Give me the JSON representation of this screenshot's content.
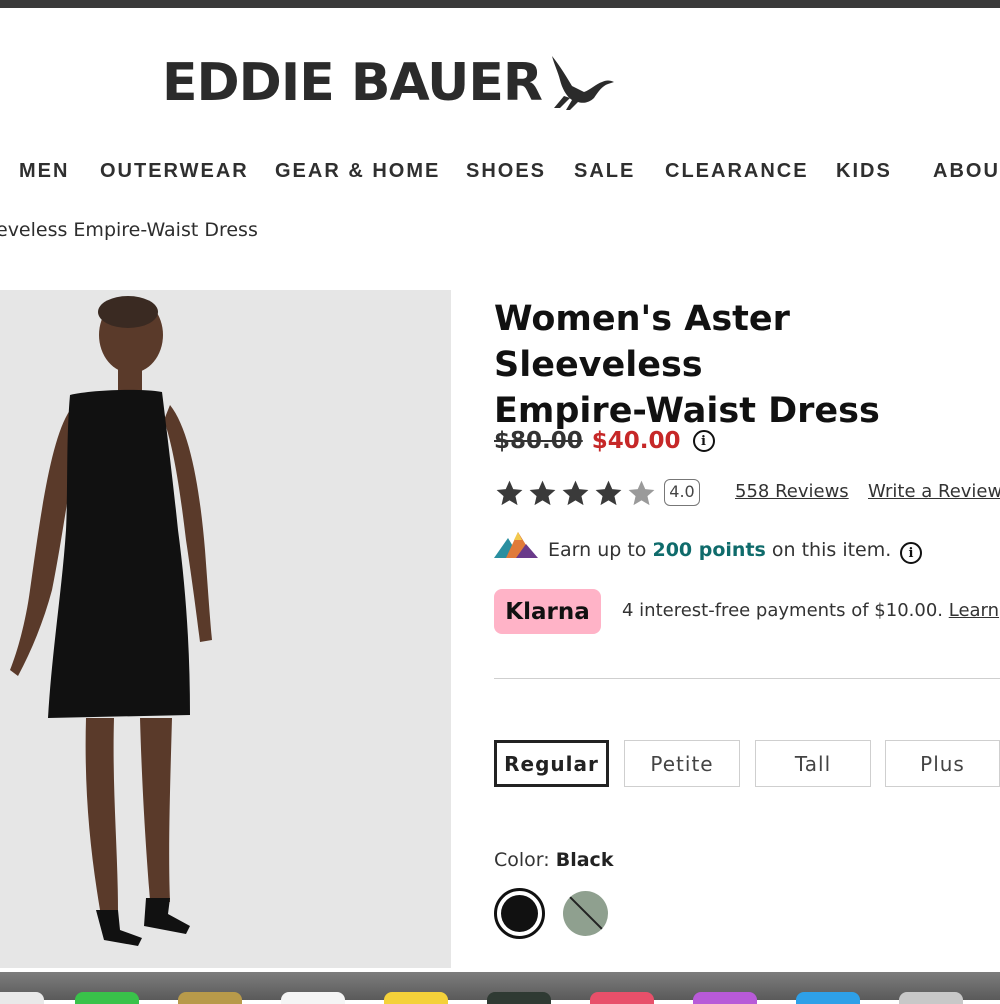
{
  "brand": {
    "name": "EDDIE BAUER",
    "bird_icon": "goose-logo-icon"
  },
  "nav": {
    "items": [
      "MEN",
      "OUTERWEAR",
      "GEAR & HOME",
      "SHOES",
      "SALE",
      "CLEARANCE",
      "KIDS",
      "ABOUT"
    ]
  },
  "breadcrumb": "eveless Empire-Waist Dress",
  "product": {
    "title_line1": "Women's Aster Sleeveless",
    "title_line2": "Empire-Waist Dress",
    "price_original": "$80.00",
    "price_sale": "$40.00",
    "sale_color": "#c62828",
    "rating_value": 4.0,
    "rating_label": "4.0",
    "reviews_link": "558 Reviews",
    "write_review_link": "Write a Review"
  },
  "rewards": {
    "text_prefix": "Earn up to",
    "points": "200 points",
    "text_suffix": "on this item."
  },
  "klarna": {
    "badge": "Klarna",
    "text": "4 interest-free payments of $10.00.",
    "learn_link": "Learn",
    "badge_color": "#ffb3c7"
  },
  "sizes": {
    "options": [
      "Regular",
      "Petite",
      "Tall",
      "Plus"
    ],
    "selected": "Regular"
  },
  "color": {
    "label": "Color:",
    "value": "Black",
    "swatches": [
      "Black",
      "Sage"
    ]
  }
}
